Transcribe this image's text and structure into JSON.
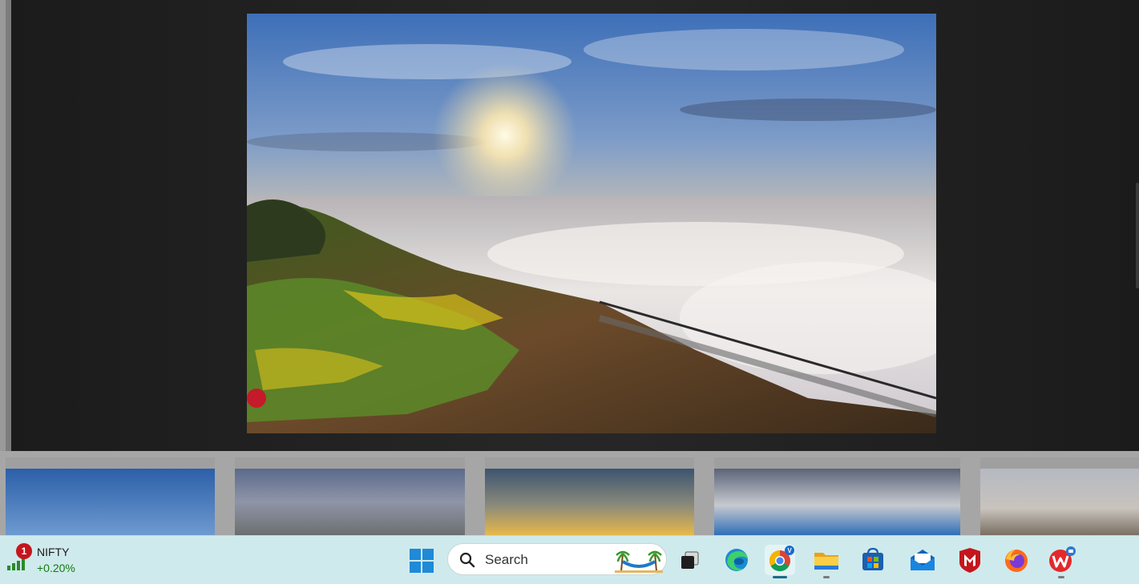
{
  "viewer": {
    "main_photo_alt": "Hilltop garden overlooking a sea of clouds at sunrise",
    "thumbnails": [
      {
        "name": "thumb-blue-sky"
      },
      {
        "name": "thumb-rocky-hill"
      },
      {
        "name": "thumb-sunset-clouds"
      },
      {
        "name": "thumb-cloudy-sky"
      },
      {
        "name": "thumb-tree-hill"
      }
    ]
  },
  "taskbar": {
    "widget": {
      "badge": "1",
      "name": "NIFTY",
      "change": "+0.20%"
    },
    "search": {
      "placeholder": "Search"
    },
    "apps": [
      {
        "name": "task-view",
        "icon": "task-view-icon"
      },
      {
        "name": "edge",
        "icon": "edge-icon"
      },
      {
        "name": "chrome",
        "icon": "chrome-icon",
        "active": true
      },
      {
        "name": "file-explorer",
        "icon": "folder-icon"
      },
      {
        "name": "microsoft-store",
        "icon": "store-icon"
      },
      {
        "name": "mail",
        "icon": "mail-icon"
      },
      {
        "name": "mcafee",
        "icon": "mcafee-icon"
      },
      {
        "name": "firefox",
        "icon": "firefox-icon"
      },
      {
        "name": "wps-office",
        "icon": "wps-icon"
      }
    ]
  },
  "colors": {
    "taskbar_bg": "#cfeaec",
    "accent": "#1a6a8a",
    "up_green": "#127a12",
    "badge_red": "#c4161c"
  }
}
